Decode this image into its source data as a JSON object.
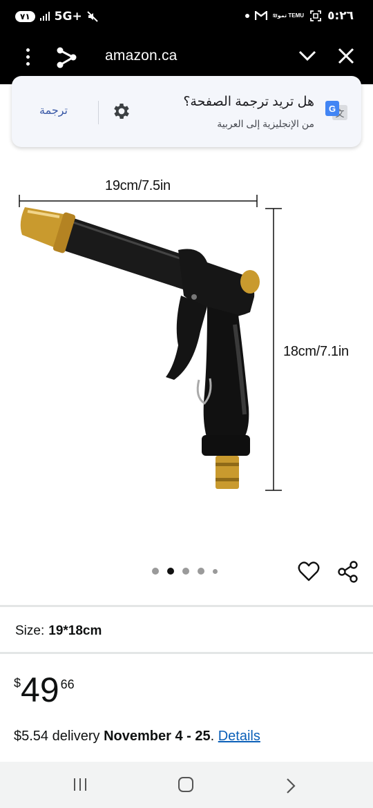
{
  "status_bar": {
    "battery": "٧١",
    "network": "5G+",
    "time": "٥:٢٦",
    "temu_label": "₪ﺗﻤﻮ TEMU"
  },
  "browser": {
    "url": "amazon.ca",
    "menu_icon": "kebab-menu-icon",
    "share_icon": "share-icon",
    "collapse_icon": "chevron-down-icon",
    "close_icon": "close-icon"
  },
  "translate_prompt": {
    "title": "هل تريد ترجمة الصفحة؟",
    "subtitle": "من الإنجليزية إلى العربية",
    "translate_button": "ترجمة"
  },
  "product_image": {
    "width_label": "19cm/7.5in",
    "height_label": "18cm/7.1in",
    "carousel_count": 5,
    "carousel_active": 2
  },
  "product": {
    "size_label": "Size:",
    "size_value": "19*18cm",
    "price_currency": "$",
    "price_whole": "49",
    "price_fraction": "66",
    "delivery_fee": "$5.54 delivery",
    "delivery_dates": "November 4 - 25",
    "delivery_period": ".",
    "details_link": "Details"
  },
  "colors": {
    "link": "#0a5fb8",
    "translate_accent": "#3b5aa7",
    "brass": "#c99a2e"
  }
}
